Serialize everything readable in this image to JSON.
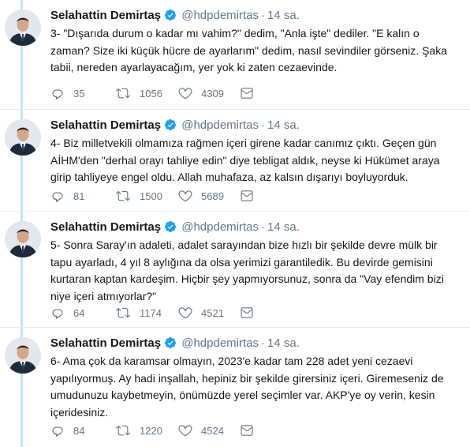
{
  "author": {
    "name": "Selahattin Demirtaş",
    "handle": "@hdpdemirtas",
    "separator": "·"
  },
  "colors": {
    "thread_line": "#c4e4f7",
    "verified": "#1da1f2",
    "muted_text": "#657786",
    "divider": "#e6ecf0"
  },
  "icons": [
    "verified-badge-icon",
    "reply-icon",
    "retweet-icon",
    "like-icon",
    "direct-message-icon"
  ],
  "tweets": [
    {
      "time": "14 sa.",
      "text": "3- \"Dışarıda durum o kadar mı vahim?\" dedim, \"Anla işte\" dediler. \"E kalın o zaman? Size iki küçük hücre de ayarlarım\" dedim, nasıl sevindiler görseniz. Şaka tabii, nereden ayarlayacağım, yer yok ki zaten cezaevinde.",
      "replies": "35",
      "retweets": "1056",
      "likes": "4309"
    },
    {
      "time": "14 sa.",
      "text": "4- Biz milletvekili olmamıza rağmen içeri girene kadar canımız çıktı. Geçen gün AİHM'den \"derhal orayı tahliye edin\" diye tebligat aldık, neyse ki Hükümet araya girip tahliyeye engel oldu. Allah muhafaza, az kalsın dışarıyı boyluyorduk.",
      "replies": "81",
      "retweets": "1500",
      "likes": "5689"
    },
    {
      "time": "14 sa.",
      "text": "5- Sonra Saray'ın adaleti, adalet sarayından bize hızlı bir şekilde devre mülk bir tapu ayarladı, 4 yıl 8 aylığına da olsa yerimizi garantiledik. Bu devirde gemisini kurtaran kaptan kardeşim. Hiçbir şey yapmıyorsunuz, sonra da \"Vay efendim bizi niye içeri atmıyorlar?\"",
      "replies": "64",
      "retweets": "1174",
      "likes": "4521"
    },
    {
      "time": "14 sa.",
      "text": "6- Ama çok da karamsar olmayın, 2023'e kadar tam 228 adet yeni cezaevi yapılıyormuş. Ay hadi inşallah, hepiniz bir şekilde girersiniz içeri. Giremeseniz de umudunuzu kaybetmeyin, önümüzde yerel seçimler var. AKP'ye oy verin, kesin içeridesiniz.",
      "replies": "84",
      "retweets": "1220",
      "likes": "4524"
    }
  ]
}
